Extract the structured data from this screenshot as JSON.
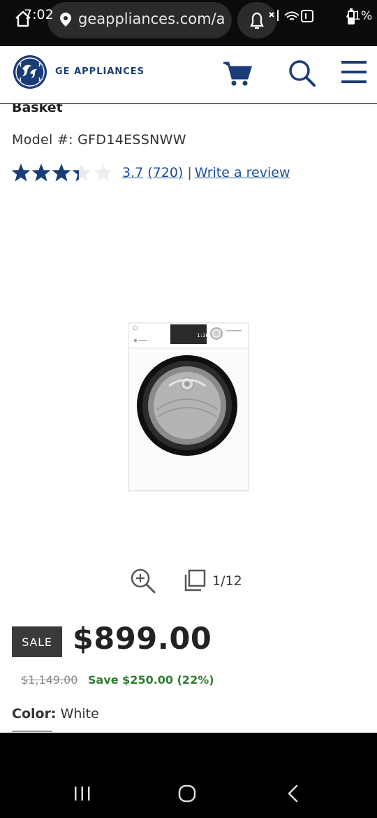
{
  "status_bar": {
    "time": "7:02",
    "url": "geappliances.com/ap",
    "battery": "41%"
  },
  "header": {
    "brand": "GE APPLIANCES",
    "icons": [
      "ge-logo",
      "cart-icon",
      "search-icon",
      "menu-icon"
    ]
  },
  "product": {
    "title_fragment": "Basket",
    "model_label": "Model #: GFD14ESSNWW",
    "rating": 3.7,
    "rating_text": "3.7",
    "reviews_count": "(720)",
    "write_review": "Write a review",
    "gallery_counter": "1/12",
    "sale_label": "SALE",
    "price": "$899.00",
    "was_price": "$1,149.00",
    "save_text": "Save $250.00 (22%)",
    "color_label": "Color:",
    "color_value": "White",
    "display_text": "1:30"
  },
  "colors": {
    "brand_blue": "#1a3c78",
    "link_blue": "#1a4e9c",
    "star_blue": "#1a3c78",
    "save_green": "#2e7d32"
  }
}
